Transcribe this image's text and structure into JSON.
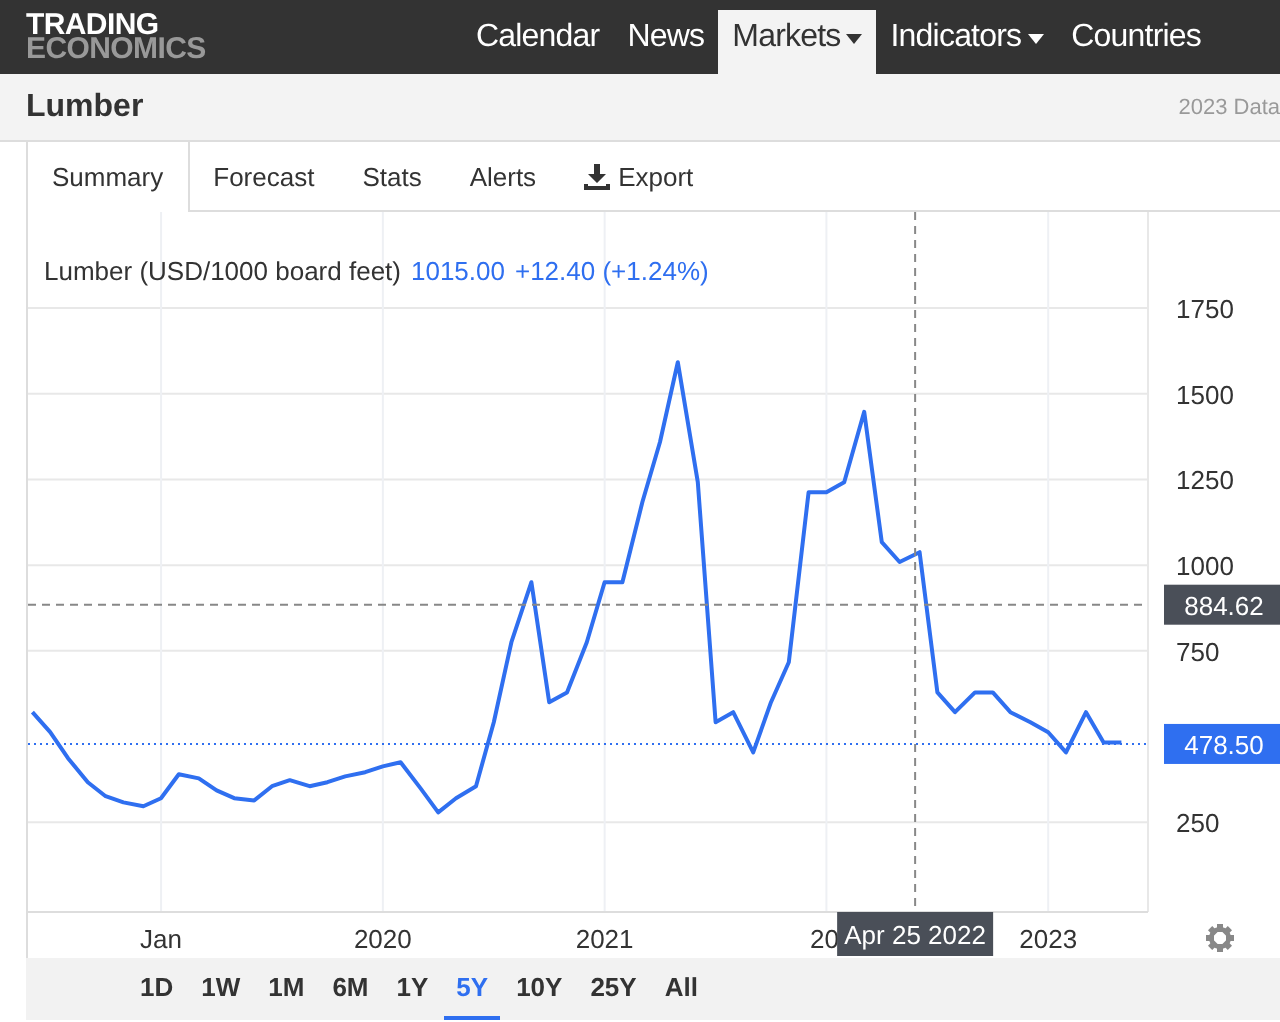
{
  "logo": {
    "line_1": "TRADING",
    "line_2": "ECONOMICS"
  },
  "nav": {
    "items": [
      {
        "label": "Calendar",
        "selected": false,
        "dropdown": false
      },
      {
        "label": "News",
        "selected": false,
        "dropdown": false
      },
      {
        "label": "Markets",
        "selected": true,
        "dropdown": true
      },
      {
        "label": "Indicators",
        "selected": false,
        "dropdown": true
      },
      {
        "label": "Countries",
        "selected": false,
        "dropdown": false
      }
    ]
  },
  "header": {
    "title": "Lumber",
    "note": "2023 Data"
  },
  "tabs": [
    {
      "label": "Summary",
      "selected": true,
      "kind": "tab"
    },
    {
      "label": "Forecast",
      "selected": false,
      "kind": "tab"
    },
    {
      "label": "Stats",
      "selected": false,
      "kind": "tab"
    },
    {
      "label": "Alerts",
      "selected": false,
      "kind": "tab"
    },
    {
      "label": "Export",
      "selected": false,
      "kind": "download"
    }
  ],
  "chart": {
    "legend": {
      "price": "1015.00",
      "change": "+12.40 (+1.24%)"
    },
    "covered_tick_label": "20",
    "chart_data": {
      "type": "line",
      "x": [
        2018.42,
        2018.5,
        2018.58,
        2018.67,
        2018.75,
        2018.83,
        2018.92,
        2019,
        2019.08,
        2019.17,
        2019.25,
        2019.33,
        2019.42,
        2019.5,
        2019.58,
        2019.67,
        2019.75,
        2019.83,
        2019.92,
        2020,
        2020.08,
        2020.17,
        2020.25,
        2020.33,
        2020.42,
        2020.5,
        2020.58,
        2020.67,
        2020.75,
        2020.83,
        2020.92,
        2021,
        2021.08,
        2021.17,
        2021.25,
        2021.33,
        2021.42,
        2021.5,
        2021.58,
        2021.67,
        2021.75,
        2021.83,
        2021.92,
        2022,
        2022.08,
        2022.17,
        2022.25,
        2022.33,
        2022.42,
        2022.5,
        2022.58,
        2022.67,
        2022.75,
        2022.83,
        2022.92,
        2023,
        2023.08,
        2023.17,
        2023.25,
        2023.33
      ],
      "series": [
        {
          "name": "Lumber (USD/1000 board feet)",
          "color": "#2f6ff0",
          "values": [
            571,
            513,
            437,
            367,
            326,
            308,
            297,
            320,
            390,
            378,
            343,
            320,
            314,
            355,
            373,
            355,
            367,
            384,
            396,
            413,
            425,
            349,
            279,
            320,
            355,
            542,
            775,
            950,
            600,
            629,
            775,
            950,
            950,
            1184,
            1359,
            1592,
            1242,
            542,
            571,
            454,
            600,
            717,
            1213,
            1213,
            1242,
            1447,
            1067,
            1009,
            1038,
            629,
            571,
            629,
            629,
            571,
            542,
            513,
            454,
            571,
            483,
            483
          ]
        }
      ],
      "xlim": [
        2018.4,
        2023.45
      ],
      "ylim": [
        0,
        2030
      ],
      "grid": true,
      "yticks": [
        250,
        750,
        1000,
        1250,
        1500,
        1750
      ],
      "xticks": [
        {
          "value": 2019,
          "label": "Jan"
        },
        2020,
        2021,
        2023
      ],
      "ref_lines": [
        {
          "axis": "y",
          "value": 884.62,
          "label": "884.62",
          "color": "#888888"
        },
        {
          "axis": "y",
          "value": 478.5,
          "label": "478.50",
          "color": "#2f6ff0"
        },
        {
          "axis": "x",
          "value": 2022.4,
          "label": "Apr 25 2022",
          "color": "#888888"
        }
      ]
    }
  },
  "ranges": [
    {
      "label": "1D",
      "selected": false
    },
    {
      "label": "1W",
      "selected": false
    },
    {
      "label": "1M",
      "selected": false
    },
    {
      "label": "6M",
      "selected": false
    },
    {
      "label": "1Y",
      "selected": false
    },
    {
      "label": "5Y",
      "selected": true
    },
    {
      "label": "10Y",
      "selected": false
    },
    {
      "label": "25Y",
      "selected": false
    },
    {
      "label": "All",
      "selected": false
    }
  ]
}
